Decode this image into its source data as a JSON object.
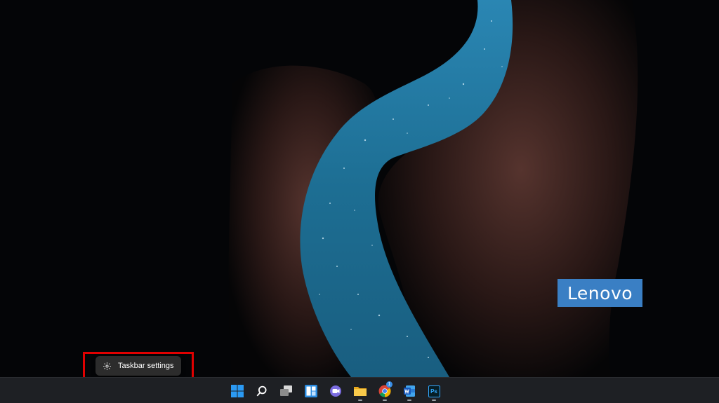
{
  "wallpaper": {
    "brand_logo": "Lenovo",
    "colors": {
      "sky": "#1f6f95",
      "rock": "#3d2420",
      "background": "#040507",
      "logo_bg": "#3a7fc4"
    }
  },
  "context_menu": {
    "items": [
      {
        "label": "Taskbar settings",
        "icon": "gear-icon"
      }
    ]
  },
  "taskbar": {
    "items": [
      {
        "name": "start",
        "icon": "windows-logo-icon",
        "running": false
      },
      {
        "name": "search",
        "icon": "search-icon",
        "running": false
      },
      {
        "name": "task-view",
        "icon": "task-view-icon",
        "running": false
      },
      {
        "name": "widgets",
        "icon": "widgets-icon",
        "running": false
      },
      {
        "name": "chat",
        "icon": "teams-chat-icon",
        "running": false
      },
      {
        "name": "file-explorer",
        "icon": "folder-icon",
        "running": true
      },
      {
        "name": "chrome",
        "icon": "chrome-icon",
        "running": true,
        "badge": "1"
      },
      {
        "name": "word",
        "icon": "word-icon",
        "running": true
      },
      {
        "name": "photoshop",
        "icon": "photoshop-icon",
        "running": true,
        "label": "Ps"
      }
    ]
  }
}
